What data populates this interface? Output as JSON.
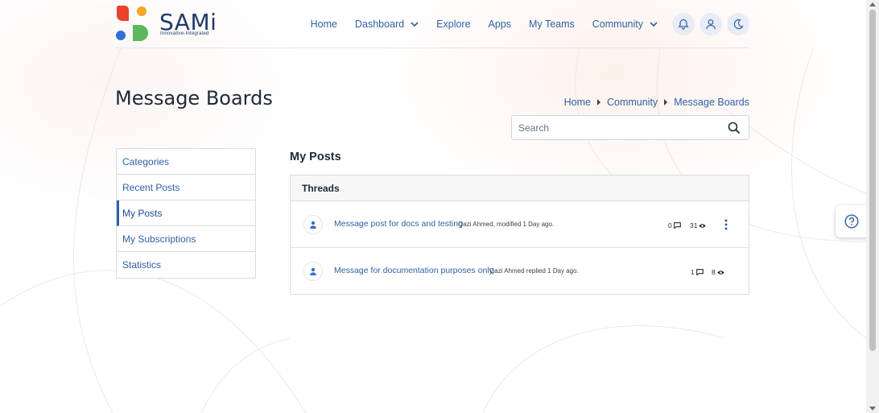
{
  "brand": {
    "name": "SAMi",
    "tagline": "Innovative-Integrated"
  },
  "nav": {
    "items": [
      {
        "label": "Home"
      },
      {
        "label": "Dashboard"
      },
      {
        "label": "Explore"
      },
      {
        "label": "Apps"
      },
      {
        "label": "My Teams"
      },
      {
        "label": "Community"
      }
    ],
    "icons": [
      "bell-icon",
      "user-icon",
      "moon-icon"
    ]
  },
  "page": {
    "title": "Message Boards"
  },
  "breadcrumb": [
    "Home",
    "Community",
    "Message Boards"
  ],
  "search": {
    "placeholder": "Search",
    "value": ""
  },
  "sidebar": {
    "items": [
      {
        "label": "Categories"
      },
      {
        "label": "Recent Posts"
      },
      {
        "label": "My Posts"
      },
      {
        "label": "My Subscriptions"
      },
      {
        "label": "Statistics"
      }
    ],
    "active": "My Posts"
  },
  "main": {
    "section_title": "My Posts",
    "threads_header": "Threads",
    "threads": [
      {
        "title": "Message post for docs and testing",
        "meta": "Qazi Ahmed, modified 1 Day ago.",
        "replies": "0",
        "views": "31"
      },
      {
        "title": "Message for documentation purposes only.",
        "meta": "Qazi Ahmed replied 1 Day ago.",
        "replies": "1",
        "views": "8"
      }
    ]
  },
  "colors": {
    "accent": "#2f5fa7",
    "brand_text": "#1e3a6b"
  }
}
